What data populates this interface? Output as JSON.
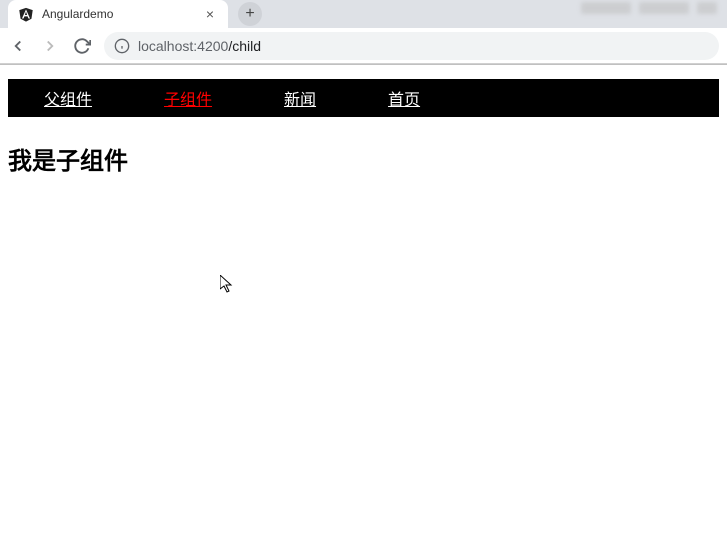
{
  "browser": {
    "tab": {
      "title": "Angulardemo",
      "close_label": "×"
    },
    "new_tab_label": "+",
    "url": {
      "host": "localhost",
      "port": ":4200",
      "path": "/child"
    }
  },
  "nav": {
    "items": [
      {
        "label": "父组件",
        "active": false
      },
      {
        "label": "子组件",
        "active": true
      },
      {
        "label": "新闻",
        "active": false
      },
      {
        "label": "首页",
        "active": false
      }
    ]
  },
  "page": {
    "heading": "我是子组件"
  }
}
